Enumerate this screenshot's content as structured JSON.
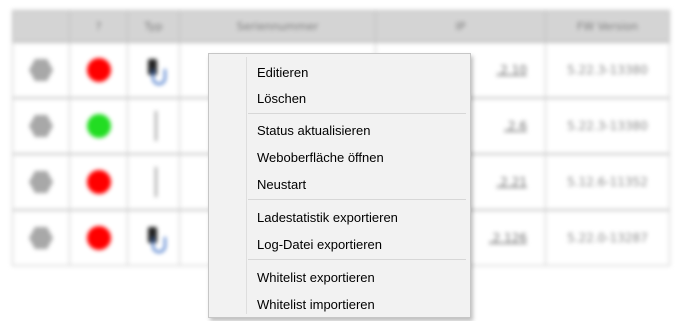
{
  "table": {
    "headers": [
      "",
      "?",
      "Typ",
      "Seriennummer",
      "IP",
      "FW Version"
    ],
    "rows": [
      {
        "status_color": "#ff0000",
        "type_icon": "charger-plug-icon",
        "ip": ".2.10",
        "fw": "5.22.3-13380"
      },
      {
        "status_color": "#22dd22",
        "type_icon": "cable-icon",
        "ip": ".2.6",
        "fw": "5.22.3-13380"
      },
      {
        "status_color": "#ff0000",
        "type_icon": "cable-icon",
        "ip": ".2.21",
        "fw": "5.12.6-11352"
      },
      {
        "status_color": "#ff0000",
        "type_icon": "charger-plug-icon",
        "ip": ".2.126",
        "fw": "5.22.0-13287"
      }
    ]
  },
  "context_menu": {
    "items": [
      "Editieren",
      "Löschen",
      "Status aktualisieren",
      "Weboberfläche öffnen",
      "Neustart",
      "Ladestatistik exportieren",
      "Log-Datei exportieren",
      "Whitelist exportieren",
      "Whitelist importieren"
    ]
  }
}
